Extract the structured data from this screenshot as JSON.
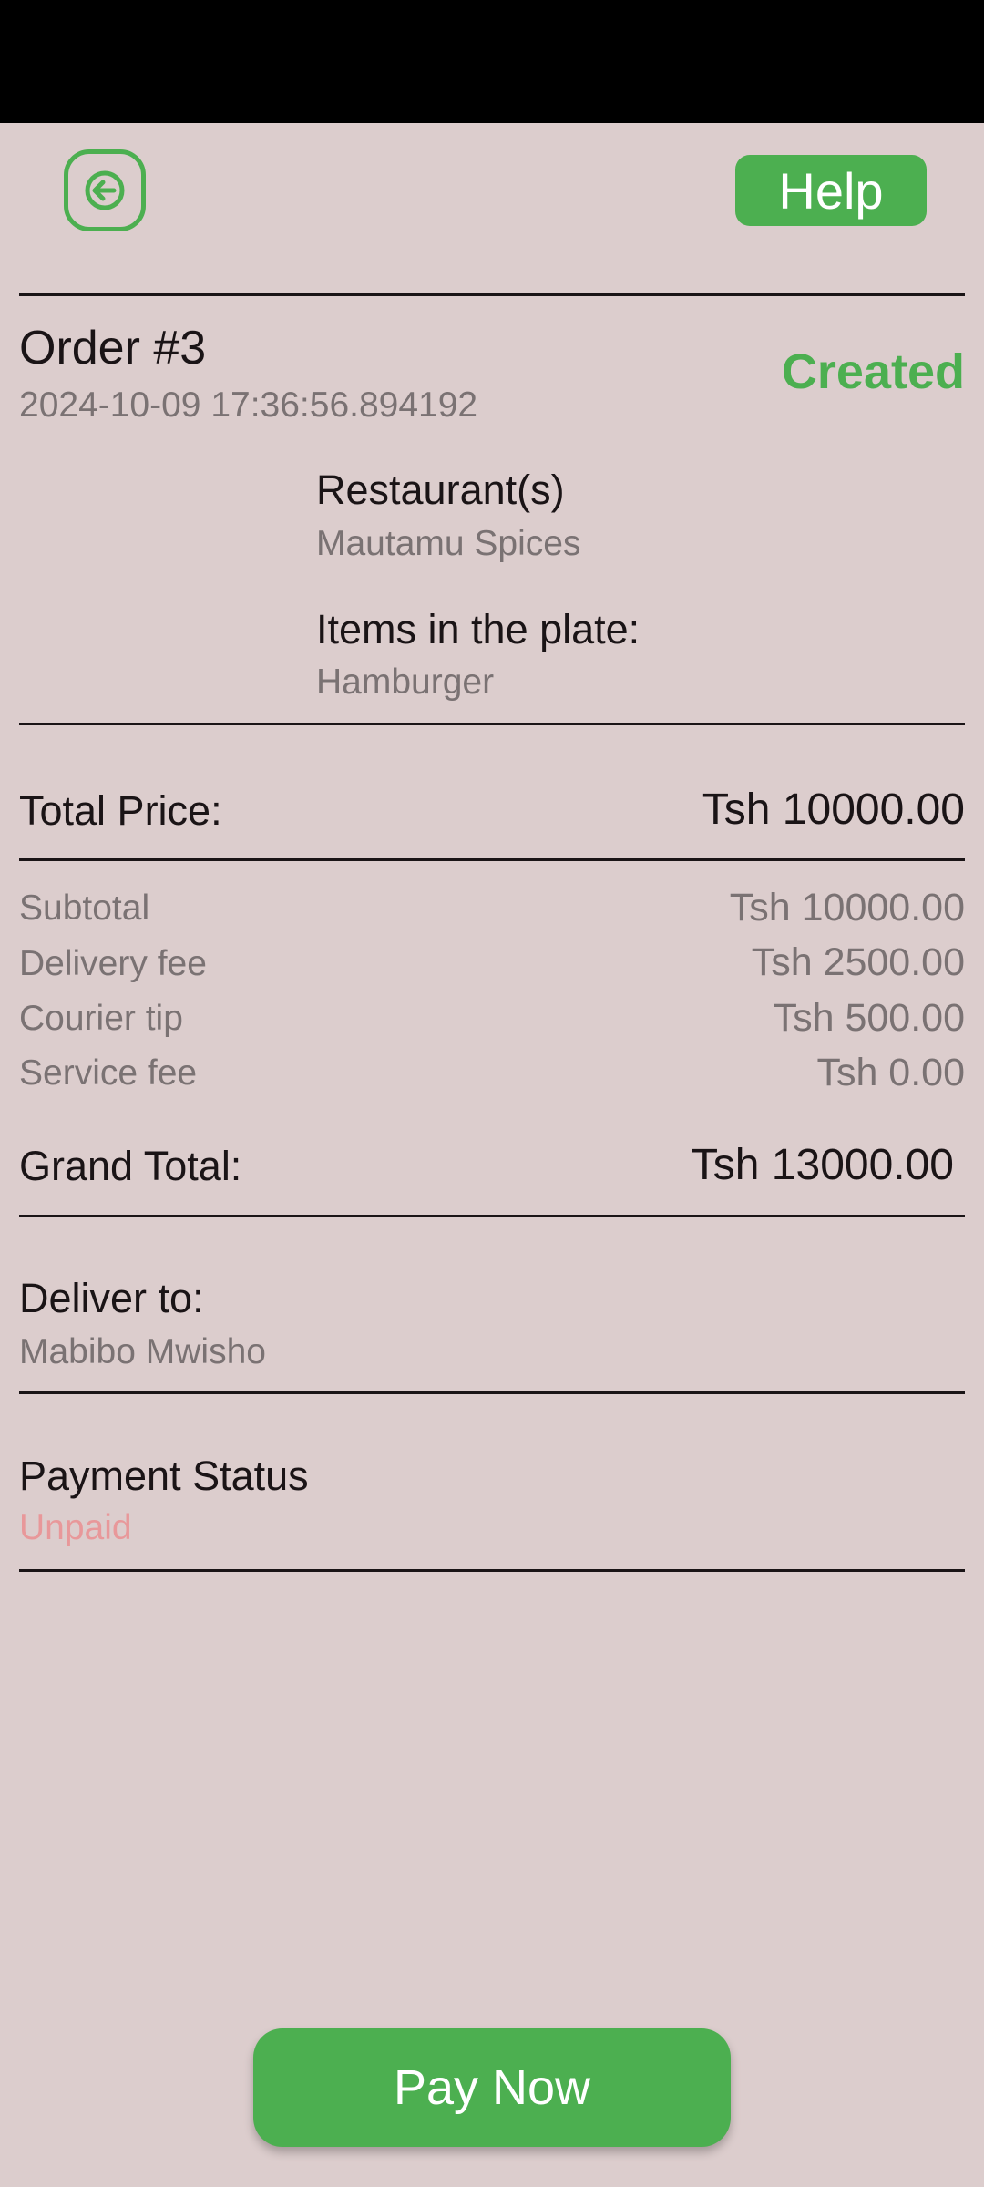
{
  "header": {
    "back_icon": "arrow-left-icon",
    "help_label": "Help",
    "accent_color": "#4caf50"
  },
  "order": {
    "title": "Order #3",
    "timestamp": "2024-10-09 17:36:56.894192",
    "status": "Created",
    "restaurants_label": "Restaurant(s)",
    "restaurants_value": "Mautamu Spices",
    "items_label": "Items in the plate:",
    "items_value": "Hamburger"
  },
  "pricing": {
    "total_price_label": "Total Price:",
    "total_price_value": "Tsh 10000.00",
    "subtotal_label": "Subtotal",
    "subtotal_value": "Tsh 10000.00",
    "delivery_fee_label": "Delivery fee",
    "delivery_fee_value": "Tsh 2500.00",
    "courier_tip_label": "Courier tip",
    "courier_tip_value": "Tsh 500.00",
    "service_fee_label": "Service fee",
    "service_fee_value": "Tsh 0.00",
    "grand_total_label": "Grand Total:",
    "grand_total_value": "Tsh 13000.00"
  },
  "delivery": {
    "label": "Deliver to:",
    "value": "Mabibo Mwisho"
  },
  "payment": {
    "label": "Payment Status",
    "value": "Unpaid",
    "value_color": "#e8989a"
  },
  "footer": {
    "pay_label": "Pay Now"
  }
}
